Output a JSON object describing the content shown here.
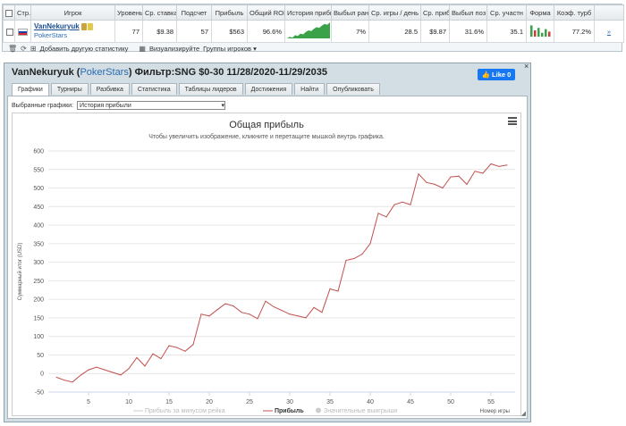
{
  "stats_table": {
    "headers": [
      "",
      "Стр.",
      "Игрок",
      "Уровень",
      "Ср. ставка",
      "Подсчет",
      "Прибыль",
      "Общий ROI",
      "История прибыли",
      "Выбыл рано",
      "Ср. игры / день",
      "Ср. приб",
      "Выбыл поз",
      "Ср. участн",
      "Форма",
      "Коэф. турб",
      ""
    ],
    "row": {
      "player": "VanNekuryuk",
      "network": "PokerStars",
      "level": "77",
      "avg_stake": "$9.38",
      "count": "57",
      "profit": "$563",
      "roi": "96.6%",
      "early_out": "7%",
      "games_per_day": "28.5",
      "avg_profit": "$9.87",
      "late_out": "31.6%",
      "avg_entrants": "35.1",
      "turbo_ratio": "77.2%",
      "link": "»"
    },
    "toolbar": {
      "add_stats": "Добавить другую статистику",
      "visualize": "Визуализируйте",
      "player_groups": "Группы игроков"
    },
    "sparkline": [
      0,
      2,
      1,
      4,
      3,
      6,
      5,
      8,
      10,
      9,
      12,
      14,
      13,
      16,
      18,
      17,
      20
    ],
    "form_bars": [
      {
        "h": 0.9,
        "c": "#3aa34a"
      },
      {
        "h": 0.5,
        "c": "#d23b3b"
      },
      {
        "h": 0.7,
        "c": "#3aa34a"
      },
      {
        "h": 0.3,
        "c": "#3aa34a"
      },
      {
        "h": 0.6,
        "c": "#3aa34a"
      },
      {
        "h": 0.4,
        "c": "#d23b3b"
      }
    ]
  },
  "panel": {
    "player": "VanNekuryuk",
    "network": "PokerStars",
    "filter": "Фильтр:SNG $0-30 11/28/2020-11/29/2035",
    "like": "Like 0",
    "close": "×",
    "tabs": [
      "Графики",
      "Турниры",
      "Разбивка",
      "Статистика",
      "Таблицы лидеров",
      "Достижения",
      "Найти",
      "Опубликовать"
    ],
    "active_tab": 0,
    "select_label": "Выбранные графики:",
    "select_value": "История прибыли"
  },
  "chart_data": {
    "type": "line",
    "title": "Общая прибыль",
    "subtitle": "Чтобы увеличить изображение, кликните и перетащите мышкой внутрь графика.",
    "xlabel": "Номер игры",
    "ylabel": "Суммарный итог (USD)",
    "xlim": [
      0,
      58
    ],
    "ylim": [
      -50,
      600
    ],
    "xticks": [
      5,
      10,
      15,
      20,
      25,
      30,
      35,
      40,
      45,
      50,
      55
    ],
    "yticks": [
      -50,
      0,
      50,
      100,
      150,
      200,
      250,
      300,
      350,
      400,
      450,
      500,
      550,
      600
    ],
    "legend": [
      {
        "name": "Прибыль за минусом рейка",
        "active": false
      },
      {
        "name": "Прибыль",
        "active": true
      },
      {
        "name": "Значительные выигрыши",
        "active": false
      }
    ],
    "line_color": "#c0504d",
    "series": [
      {
        "name": "Прибыль",
        "x": [
          1,
          2,
          3,
          4,
          5,
          6,
          7,
          8,
          9,
          10,
          11,
          12,
          13,
          14,
          15,
          16,
          17,
          18,
          19,
          20,
          21,
          22,
          23,
          24,
          25,
          26,
          27,
          28,
          29,
          30,
          31,
          32,
          33,
          34,
          35,
          36,
          37,
          38,
          39,
          40,
          41,
          42,
          43,
          44,
          45,
          46,
          47,
          48,
          49,
          50,
          51,
          52,
          53,
          54,
          55,
          56,
          57
        ],
        "values": [
          -10,
          -18,
          -23,
          -5,
          10,
          17,
          10,
          3,
          -4,
          13,
          43,
          20,
          53,
          40,
          75,
          70,
          60,
          78,
          160,
          155,
          172,
          188,
          182,
          165,
          160,
          148,
          195,
          180,
          170,
          160,
          155,
          150,
          178,
          165,
          228,
          222,
          305,
          310,
          322,
          350,
          432,
          422,
          455,
          462,
          455,
          538,
          515,
          510,
          500,
          530,
          532,
          510,
          545,
          540,
          565,
          558,
          562
        ]
      }
    ]
  }
}
